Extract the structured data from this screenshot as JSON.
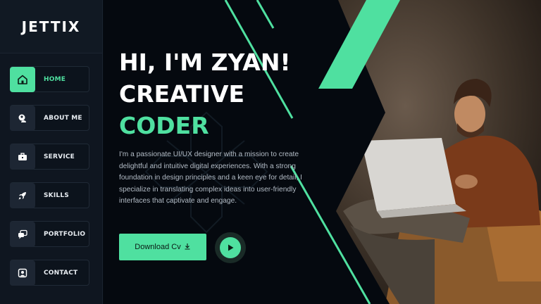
{
  "brand": {
    "logo": "JETTIX"
  },
  "sidebar": {
    "items": [
      {
        "label": "HOME",
        "icon": "home-icon",
        "active": true
      },
      {
        "label": "ABOUT ME",
        "icon": "user-icon",
        "active": false
      },
      {
        "label": "SERVICE",
        "icon": "briefcase-icon",
        "active": false
      },
      {
        "label": "SKILLS",
        "icon": "rocket-icon",
        "active": false
      },
      {
        "label": "PORTFOLIO",
        "icon": "chat-icon",
        "active": false
      },
      {
        "label": "CONTACT",
        "icon": "contact-icon",
        "active": false
      }
    ]
  },
  "hero": {
    "line1": "HI, I'M ZYAN!",
    "line2": "CREATIVE",
    "line3": "CODER",
    "bio": "I'm a passionate UI/UX designer with a mission to create delightful and intuitive digital experiences. With a strong foundation in design principles and a keen eye for detail, I specialize in translating complex ideas into user-friendly interfaces that captivate and engage.",
    "cta_label": "Download Cv"
  },
  "colors": {
    "accent": "#4fe0a0",
    "background": "#05090f",
    "sidebar": "#0f1620"
  }
}
